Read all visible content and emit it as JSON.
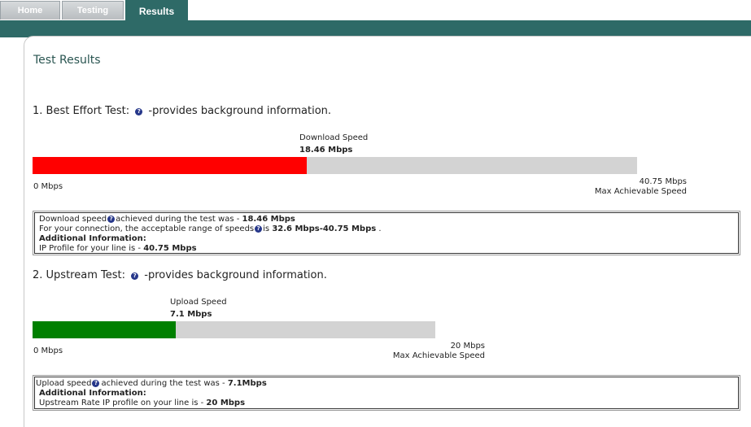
{
  "tabs": [
    {
      "label": "Home"
    },
    {
      "label": "Testing"
    },
    {
      "label": "Results"
    }
  ],
  "page_title": "Test Results",
  "sections": [
    {
      "title_prefix": "1. Best Effort Test:",
      "title_suffix": "-provides background information.",
      "speed_label": "Download Speed",
      "speed_value": "18.46 Mbps",
      "fill_fraction": 0.453,
      "fill_color": "#ff0000",
      "min_label": "0 Mbps",
      "max_value": "40.75 Mbps",
      "max_label": "Max Achievable Speed",
      "info": {
        "line1_a": "Download speed",
        "line1_b": "achieved during the test was -",
        "line1_value": "18.46 Mbps",
        "line2_a": "For your connection, the acceptable range of speeds",
        "line2_b": "is",
        "line2_value": "32.6 Mbps-40.75 Mbps",
        "line2_end": ".",
        "additional": "Additional Information:",
        "line3_a": "IP Profile for your line is -",
        "line3_value": "40.75 Mbps"
      }
    },
    {
      "title_prefix": "2. Upstream Test:",
      "title_suffix": "-provides background information.",
      "speed_label": "Upload Speed",
      "speed_value": "7.1 Mbps",
      "fill_fraction": 0.355,
      "fill_color": "#008000",
      "min_label": "0 Mbps",
      "max_value": "20 Mbps",
      "max_label": "Max Achievable Speed",
      "info": {
        "line1_a": "Upload speed",
        "line1_b": "achieved during the test was -",
        "line1_value": "7.1Mbps",
        "additional": "Additional Information:",
        "line3_a": "Upstream Rate IP profile on your line is -",
        "line3_value": "20 Mbps"
      }
    }
  ]
}
